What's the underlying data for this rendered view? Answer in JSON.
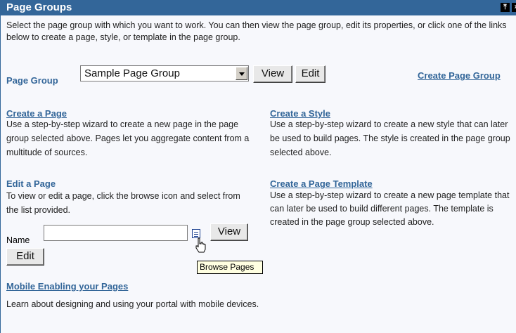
{
  "portlet": {
    "title": "Page Groups",
    "intro": "Select the page group with which you want to work. You can then view the page group, edit its properties, or click one of the links below to create a page, style, or template in the page group."
  },
  "page_group": {
    "label": "Page Group",
    "selected": "Sample Page Group",
    "view_label": "View",
    "edit_label": "Edit",
    "create_link": "Create Page Group"
  },
  "sections": {
    "create_page": {
      "title": "Create a Page",
      "text": "Use a step-by-step wizard to create a new page in the page group selected above. Pages let you aggregate content from a multitude of sources."
    },
    "create_style": {
      "title": "Create a Style",
      "text": "Use a step-by-step wizard to create a new style that can later be used to build pages. The style is created in the page group selected above."
    },
    "edit_page": {
      "title": "Edit a Page",
      "text": "To view or edit a page, click the browse icon and select from the list provided.",
      "name_label": "Name",
      "name_value": "",
      "view_label": "View",
      "edit_label": "Edit",
      "tooltip": "Browse Pages"
    },
    "create_template": {
      "title": "Create a Page Template",
      "text": "Use a step-by-step wizard to create a new page template that can later be used to build different pages. The template is created in the page group selected above."
    },
    "mobile": {
      "title": "Mobile Enabling your Pages",
      "text": "Learn about designing and using your portal with mobile devices."
    }
  },
  "colors": {
    "title_bar": "#336699",
    "link": "#336699",
    "panel_bg": "#f7f8fc"
  },
  "icons": [
    "collapse-icon",
    "close-icon",
    "browse-icon",
    "hand-cursor-icon"
  ]
}
